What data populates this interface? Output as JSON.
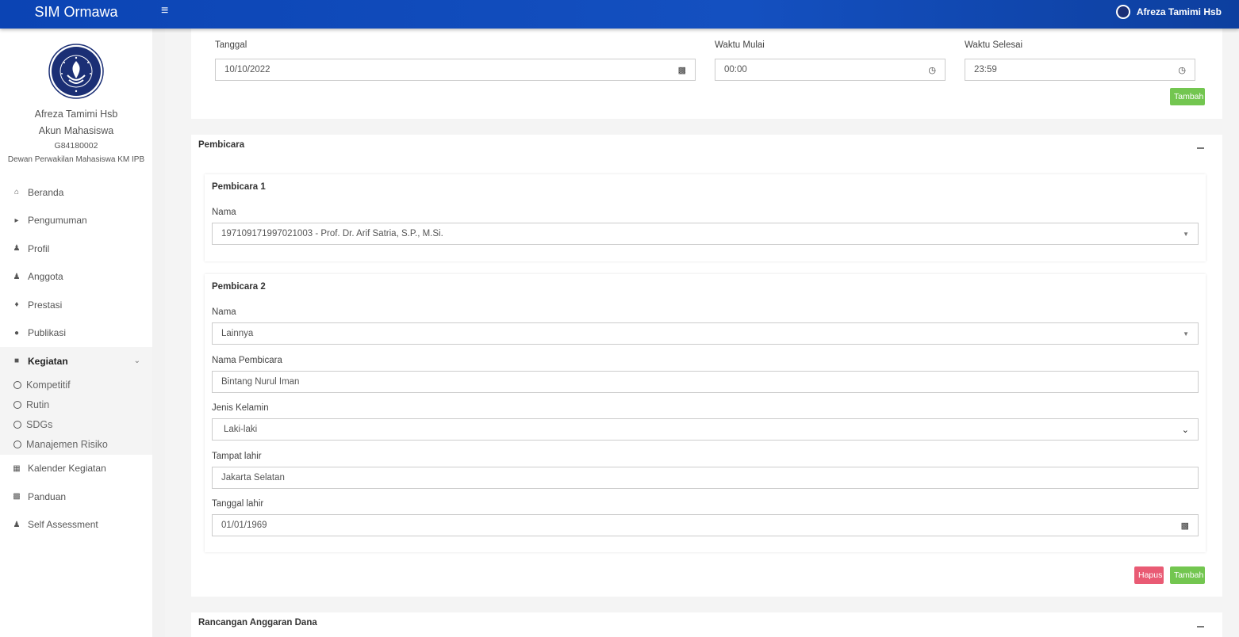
{
  "topbar": {
    "brand": "SIM Ormawa",
    "menu_icon": "hamburger-icon",
    "user_name": "Afreza Tamimi Hsb"
  },
  "sidebar": {
    "profile": {
      "name": "Afreza Tamimi Hsb",
      "role": "Akun Mahasiswa",
      "id": "G84180002",
      "org": "Dewan Perwakilan Mahasiswa KM IPB"
    },
    "items": [
      {
        "label": "Beranda",
        "icon": "home-icon"
      },
      {
        "label": "Pengumuman",
        "icon": "megaphone-icon"
      },
      {
        "label": "Profil",
        "icon": "user-icon"
      },
      {
        "label": "Anggota",
        "icon": "users-icon"
      },
      {
        "label": "Prestasi",
        "icon": "trophy-icon"
      },
      {
        "label": "Publikasi",
        "icon": "comments-icon"
      },
      {
        "label": "Kegiatan",
        "icon": "folder-icon"
      }
    ],
    "kegiatan_sub": [
      {
        "label": "Kompetitif"
      },
      {
        "label": "Rutin"
      },
      {
        "label": "SDGs"
      },
      {
        "label": "Manajemen Risiko"
      }
    ],
    "items_after": [
      {
        "label": "Kalender Kegiatan",
        "icon": "calendar-icon"
      },
      {
        "label": "Panduan",
        "icon": "book-icon"
      },
      {
        "label": "Self Assessment",
        "icon": "user-icon"
      }
    ]
  },
  "schedule": {
    "tanggal_label": "Tanggal",
    "tanggal_value": "10/10/2022",
    "mulai_label": "Waktu Mulai",
    "mulai_value": "00:00",
    "selesai_label": "Waktu Selesai",
    "selesai_value": "23:59",
    "add_label": "Tambah"
  },
  "pembicara": {
    "title": "Pembicara",
    "p1": {
      "title": "Pembicara 1",
      "nama_label": "Nama",
      "nama_value": "197109171997021003 - Prof. Dr. Arif Satria, S.P., M.Si."
    },
    "p2": {
      "title": "Pembicara 2",
      "nama_label": "Nama",
      "nama_value": "Lainnya",
      "nama_pembicara_label": "Nama Pembicara",
      "nama_pembicara_value": "Bintang Nurul Iman",
      "jk_label": "Jenis Kelamin",
      "jk_value": "Laki-laki",
      "tempat_label": "Tampat lahir",
      "tempat_value": "Jakarta Selatan",
      "tgl_label": "Tanggal lahir",
      "tgl_value": "01/01/1969"
    },
    "delete_label": "Hapus",
    "add_label": "Tambah"
  },
  "rab": {
    "title": "Rancangan Anggaran Dana"
  }
}
